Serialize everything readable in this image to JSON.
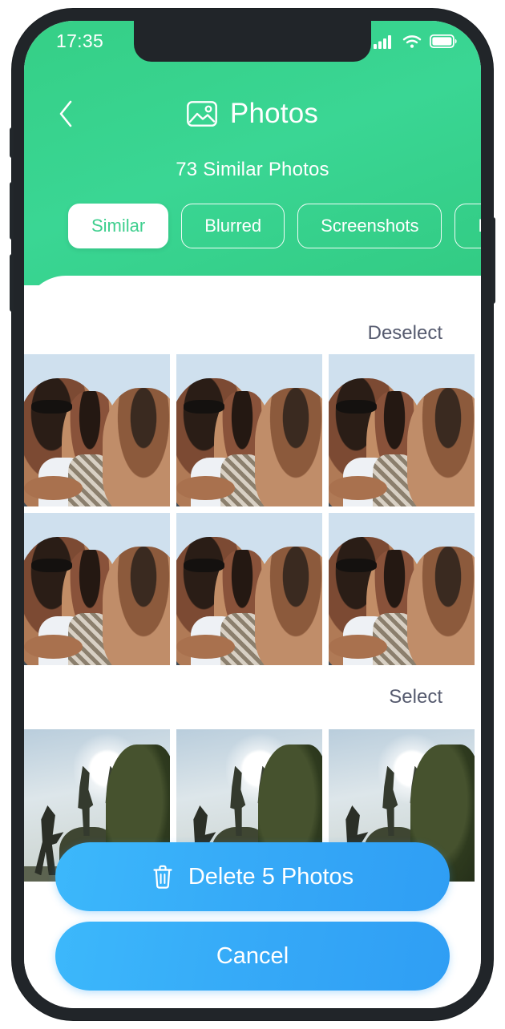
{
  "status_bar": {
    "time": "17:35",
    "icons": [
      "cellular-signal-icon",
      "wifi-icon",
      "battery-icon"
    ]
  },
  "header": {
    "back_icon": "chevron-left-icon",
    "title_icon": "image-icon",
    "title": "Photos",
    "subtitle": "73 Similar Photos",
    "accent_color": "#3ecf8e"
  },
  "filters": {
    "chips": [
      {
        "label": "Similar",
        "active": true
      },
      {
        "label": "Blurred",
        "active": false
      },
      {
        "label": "Screenshots",
        "active": false
      },
      {
        "label": "Places",
        "active": false
      }
    ]
  },
  "groups": [
    {
      "action_label": "Deselect",
      "photos": [
        {
          "kind": "selfie",
          "selected": false
        },
        {
          "kind": "selfie",
          "selected": true
        },
        {
          "kind": "selfie",
          "selected": true
        },
        {
          "kind": "selfie",
          "selected": true
        },
        {
          "kind": "selfie",
          "selected": true
        },
        {
          "kind": "selfie",
          "selected": true
        }
      ]
    },
    {
      "action_label": "Select",
      "photos": [
        {
          "kind": "hike",
          "selected": false
        },
        {
          "kind": "hike",
          "selected": false
        },
        {
          "kind": "hike",
          "selected": false
        }
      ]
    }
  ],
  "bottom_actions": {
    "delete_icon": "trash-icon",
    "delete_label": "Delete 5 Photos",
    "cancel_label": "Cancel",
    "button_color": "#35a8f7"
  }
}
